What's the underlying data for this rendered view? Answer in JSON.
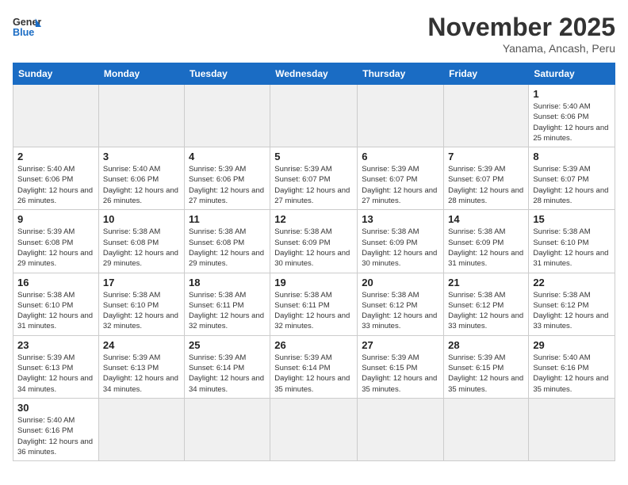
{
  "header": {
    "logo_general": "General",
    "logo_blue": "Blue",
    "month_title": "November 2025",
    "location": "Yanama, Ancash, Peru"
  },
  "weekdays": [
    "Sunday",
    "Monday",
    "Tuesday",
    "Wednesday",
    "Thursday",
    "Friday",
    "Saturday"
  ],
  "weeks": [
    [
      {
        "day": "",
        "info": ""
      },
      {
        "day": "",
        "info": ""
      },
      {
        "day": "",
        "info": ""
      },
      {
        "day": "",
        "info": ""
      },
      {
        "day": "",
        "info": ""
      },
      {
        "day": "",
        "info": ""
      },
      {
        "day": "1",
        "info": "Sunrise: 5:40 AM\nSunset: 6:06 PM\nDaylight: 12 hours and 25 minutes."
      }
    ],
    [
      {
        "day": "2",
        "info": "Sunrise: 5:40 AM\nSunset: 6:06 PM\nDaylight: 12 hours and 26 minutes."
      },
      {
        "day": "3",
        "info": "Sunrise: 5:40 AM\nSunset: 6:06 PM\nDaylight: 12 hours and 26 minutes."
      },
      {
        "day": "4",
        "info": "Sunrise: 5:39 AM\nSunset: 6:06 PM\nDaylight: 12 hours and 27 minutes."
      },
      {
        "day": "5",
        "info": "Sunrise: 5:39 AM\nSunset: 6:07 PM\nDaylight: 12 hours and 27 minutes."
      },
      {
        "day": "6",
        "info": "Sunrise: 5:39 AM\nSunset: 6:07 PM\nDaylight: 12 hours and 27 minutes."
      },
      {
        "day": "7",
        "info": "Sunrise: 5:39 AM\nSunset: 6:07 PM\nDaylight: 12 hours and 28 minutes."
      },
      {
        "day": "8",
        "info": "Sunrise: 5:39 AM\nSunset: 6:07 PM\nDaylight: 12 hours and 28 minutes."
      }
    ],
    [
      {
        "day": "9",
        "info": "Sunrise: 5:39 AM\nSunset: 6:08 PM\nDaylight: 12 hours and 29 minutes."
      },
      {
        "day": "10",
        "info": "Sunrise: 5:38 AM\nSunset: 6:08 PM\nDaylight: 12 hours and 29 minutes."
      },
      {
        "day": "11",
        "info": "Sunrise: 5:38 AM\nSunset: 6:08 PM\nDaylight: 12 hours and 29 minutes."
      },
      {
        "day": "12",
        "info": "Sunrise: 5:38 AM\nSunset: 6:09 PM\nDaylight: 12 hours and 30 minutes."
      },
      {
        "day": "13",
        "info": "Sunrise: 5:38 AM\nSunset: 6:09 PM\nDaylight: 12 hours and 30 minutes."
      },
      {
        "day": "14",
        "info": "Sunrise: 5:38 AM\nSunset: 6:09 PM\nDaylight: 12 hours and 31 minutes."
      },
      {
        "day": "15",
        "info": "Sunrise: 5:38 AM\nSunset: 6:10 PM\nDaylight: 12 hours and 31 minutes."
      }
    ],
    [
      {
        "day": "16",
        "info": "Sunrise: 5:38 AM\nSunset: 6:10 PM\nDaylight: 12 hours and 31 minutes."
      },
      {
        "day": "17",
        "info": "Sunrise: 5:38 AM\nSunset: 6:10 PM\nDaylight: 12 hours and 32 minutes."
      },
      {
        "day": "18",
        "info": "Sunrise: 5:38 AM\nSunset: 6:11 PM\nDaylight: 12 hours and 32 minutes."
      },
      {
        "day": "19",
        "info": "Sunrise: 5:38 AM\nSunset: 6:11 PM\nDaylight: 12 hours and 32 minutes."
      },
      {
        "day": "20",
        "info": "Sunrise: 5:38 AM\nSunset: 6:12 PM\nDaylight: 12 hours and 33 minutes."
      },
      {
        "day": "21",
        "info": "Sunrise: 5:38 AM\nSunset: 6:12 PM\nDaylight: 12 hours and 33 minutes."
      },
      {
        "day": "22",
        "info": "Sunrise: 5:38 AM\nSunset: 6:12 PM\nDaylight: 12 hours and 33 minutes."
      }
    ],
    [
      {
        "day": "23",
        "info": "Sunrise: 5:39 AM\nSunset: 6:13 PM\nDaylight: 12 hours and 34 minutes."
      },
      {
        "day": "24",
        "info": "Sunrise: 5:39 AM\nSunset: 6:13 PM\nDaylight: 12 hours and 34 minutes."
      },
      {
        "day": "25",
        "info": "Sunrise: 5:39 AM\nSunset: 6:14 PM\nDaylight: 12 hours and 34 minutes."
      },
      {
        "day": "26",
        "info": "Sunrise: 5:39 AM\nSunset: 6:14 PM\nDaylight: 12 hours and 35 minutes."
      },
      {
        "day": "27",
        "info": "Sunrise: 5:39 AM\nSunset: 6:15 PM\nDaylight: 12 hours and 35 minutes."
      },
      {
        "day": "28",
        "info": "Sunrise: 5:39 AM\nSunset: 6:15 PM\nDaylight: 12 hours and 35 minutes."
      },
      {
        "day": "29",
        "info": "Sunrise: 5:40 AM\nSunset: 6:16 PM\nDaylight: 12 hours and 35 minutes."
      }
    ],
    [
      {
        "day": "30",
        "info": "Sunrise: 5:40 AM\nSunset: 6:16 PM\nDaylight: 12 hours and 36 minutes."
      },
      {
        "day": "",
        "info": ""
      },
      {
        "day": "",
        "info": ""
      },
      {
        "day": "",
        "info": ""
      },
      {
        "day": "",
        "info": ""
      },
      {
        "day": "",
        "info": ""
      },
      {
        "day": "",
        "info": ""
      }
    ]
  ]
}
